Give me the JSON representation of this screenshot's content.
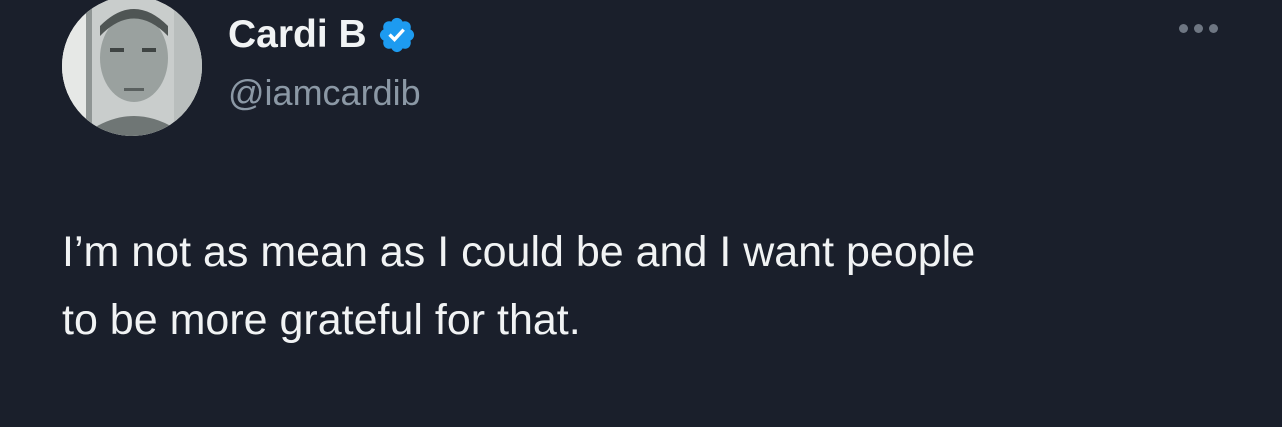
{
  "author": {
    "display_name": "Cardi B",
    "handle": "@iamcardib",
    "verified": true,
    "avatar_icon": "profile-photo"
  },
  "tweet": {
    "text_line1": "I’m not as mean as I could be and I want people",
    "text_line2": "to be more grateful for that."
  },
  "more_menu_icon": "ellipsis-icon",
  "colors": {
    "background": "#1a1f2b",
    "text": "#f1f3f4",
    "secondary_text": "#8b98a5",
    "verified_badge": "#1d9bf0"
  }
}
